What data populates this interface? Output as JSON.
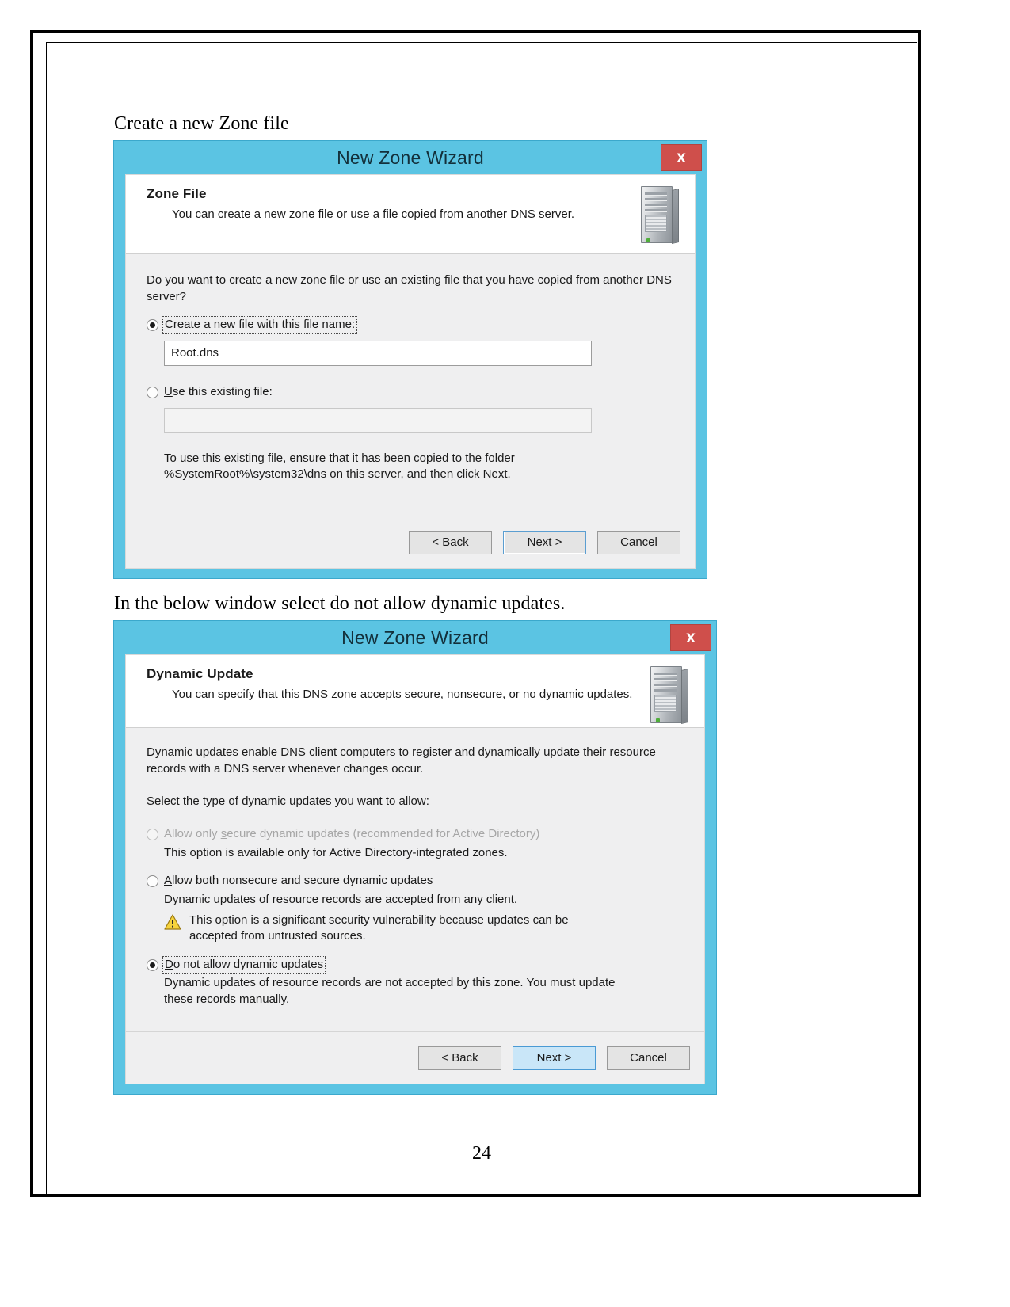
{
  "document": {
    "caption_1": "Create a new Zone file",
    "caption_2": "In the below window select do not allow dynamic updates.",
    "page_number": "24"
  },
  "dialog_zone_file": {
    "title": "New Zone Wizard",
    "close_label": "x",
    "header": {
      "heading": "Zone File",
      "subheading": "You can create a new zone file or use a file copied from another DNS server.",
      "icon": "server-tower-icon"
    },
    "prompt": "Do you want to create a new zone file or use an existing file that you have copied from another DNS server?",
    "option_create": {
      "label": "Create a new file with this file name:",
      "selected": true,
      "value": "Root.dns"
    },
    "option_existing": {
      "label": "Use this existing file:",
      "selected": false,
      "value": ""
    },
    "note": "To use this existing file, ensure that it has been copied to the folder %SystemRoot%\\system32\\dns on this server, and then click Next.",
    "buttons": {
      "back": "< Back",
      "next": "Next >",
      "cancel": "Cancel"
    }
  },
  "dialog_dynamic_update": {
    "title": "New Zone Wizard",
    "close_label": "x",
    "header": {
      "heading": "Dynamic Update",
      "subheading": "You can specify that this DNS zone accepts secure, nonsecure, or no dynamic updates.",
      "icon": "server-tower-icon"
    },
    "intro": "Dynamic updates enable DNS client computers to register and dynamically update their resource records with a DNS server whenever changes occur.",
    "select_prompt": "Select the type of dynamic updates you want to allow:",
    "option_secure": {
      "label": "Allow only secure dynamic updates (recommended for Active Directory)",
      "description": "This option is available only for Active Directory-integrated zones.",
      "selected": false,
      "disabled": true
    },
    "option_both": {
      "label": "Allow both nonsecure and secure dynamic updates",
      "description": "Dynamic updates of resource records are accepted from any client.",
      "warning": "This option is a significant security vulnerability because updates can be accepted from untrusted sources.",
      "warning_icon": "warning-triangle-icon",
      "selected": false,
      "disabled": false
    },
    "option_none": {
      "label": "Do not allow dynamic updates",
      "description": "Dynamic updates of resource records are not accepted by this zone. You must update these records manually.",
      "selected": true,
      "disabled": false
    },
    "buttons": {
      "back": "< Back",
      "next": "Next >",
      "cancel": "Cancel"
    }
  }
}
